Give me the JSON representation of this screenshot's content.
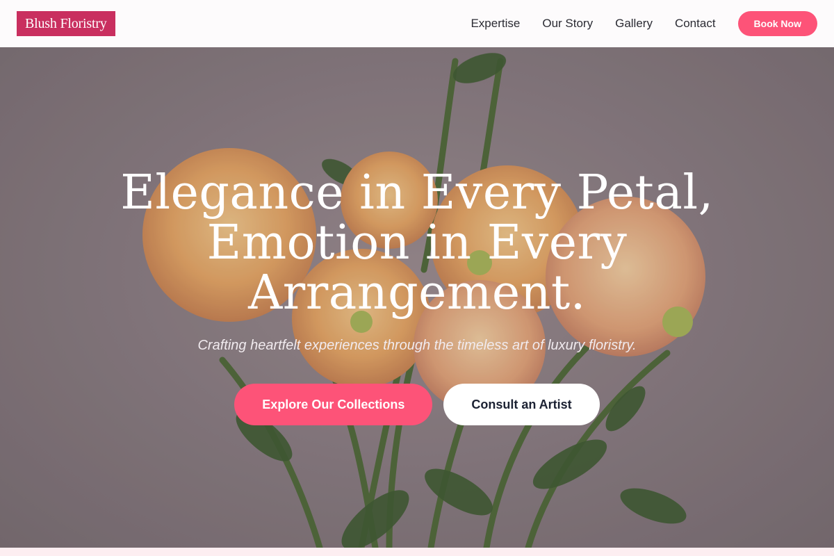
{
  "brand": {
    "name": "Blush Floristry"
  },
  "nav": {
    "links": [
      "Expertise",
      "Our Story",
      "Gallery",
      "Contact"
    ],
    "cta_label": "Book Now"
  },
  "hero": {
    "title_lines": [
      "Elegance in Every Petal,",
      "Emotion in Every",
      "Arrangement."
    ],
    "subtitle": "Crafting heartfelt experiences through the timeless art of luxury floristry.",
    "primary_cta": "Explore Our Collections",
    "secondary_cta": "Consult an Artist",
    "image_icon": "dahlia-bouquet-photo"
  },
  "colors": {
    "brand": "#c92f5f",
    "accent": "#fd5378",
    "nav_text": "#2b2b33",
    "hero_background": "#8b7f84"
  }
}
